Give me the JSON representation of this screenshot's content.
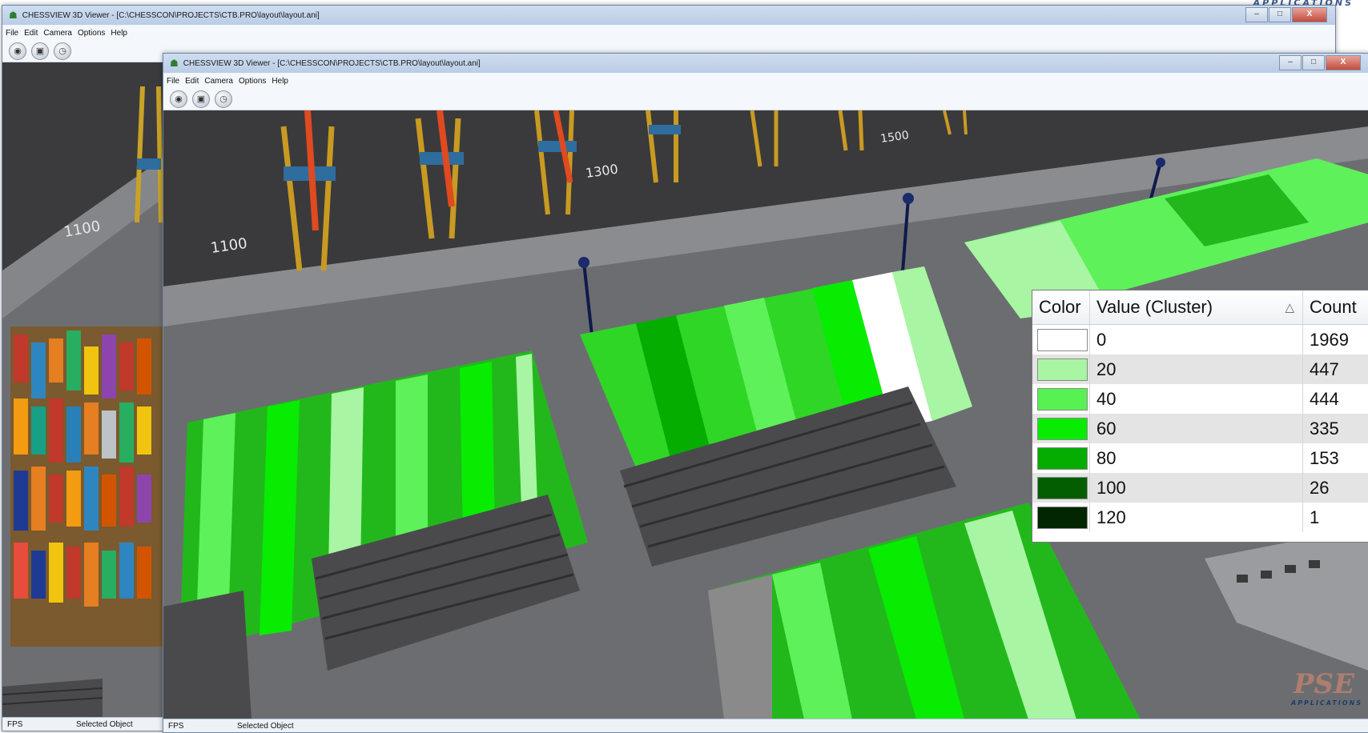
{
  "brand": {
    "top_text": "APPLICATIONS",
    "logo_text": "PSE",
    "logo_sub": "APPLICATIONS"
  },
  "back_window": {
    "title": "CHESSVIEW 3D Viewer - [C:\\CHESSCON\\PROJECTS\\CTB.PRO\\layout\\layout.ani]",
    "menu": [
      "File",
      "Edit",
      "Camera",
      "Options",
      "Help"
    ],
    "toolbar_icons": [
      "camera-icon",
      "screenshot-icon",
      "clock-icon"
    ],
    "quay_label": "1100",
    "status": {
      "fps": "FPS",
      "selected": "Selected Object"
    }
  },
  "front_window": {
    "title": "CHESSVIEW 3D Viewer - [C:\\CHESSCON\\PROJECTS\\CTB.PRO\\layout\\layout.ani]",
    "menu": [
      "File",
      "Edit",
      "Camera",
      "Options",
      "Help"
    ],
    "toolbar_icons": [
      "camera-icon",
      "screenshot-icon",
      "clock-icon"
    ],
    "quay_labels": [
      "1100",
      "1300",
      "1500"
    ],
    "status": {
      "fps": "FPS",
      "selected": "Selected Object"
    }
  },
  "window_buttons": {
    "minimize": "–",
    "maximize": "□",
    "close": "X"
  },
  "legend": {
    "headers": {
      "color": "Color",
      "value": "Value (Cluster)",
      "count": "Count"
    },
    "rows": [
      {
        "value": "0",
        "count": "1969",
        "color": "#ffffff"
      },
      {
        "value": "20",
        "count": "447",
        "color": "#a8f5a3"
      },
      {
        "value": "40",
        "count": "444",
        "color": "#57f152"
      },
      {
        "value": "60",
        "count": "335",
        "color": "#07ec00"
      },
      {
        "value": "80",
        "count": "153",
        "color": "#04ad00"
      },
      {
        "value": "100",
        "count": "26",
        "color": "#035e00"
      },
      {
        "value": "120",
        "count": "1",
        "color": "#012600"
      }
    ]
  }
}
